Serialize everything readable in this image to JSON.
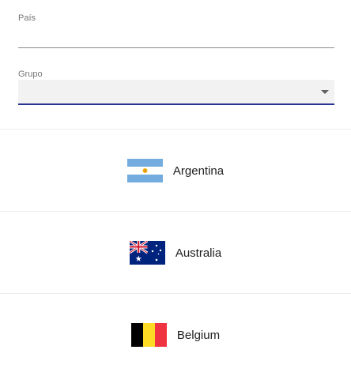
{
  "form": {
    "pais": {
      "label": "País",
      "value": ""
    },
    "grupo": {
      "label": "Grupo",
      "selected": "",
      "icon": "dropdown-arrow-icon"
    }
  },
  "countries": [
    {
      "name": "Argentina",
      "flag_icon": "argentina-flag-icon"
    },
    {
      "name": "Australia",
      "flag_icon": "australia-flag-icon"
    },
    {
      "name": "Belgium",
      "flag_icon": "belgium-flag-icon"
    }
  ],
  "colors": {
    "select_underline": "#283593",
    "select_background": "#f2f2f2",
    "divider": "#ececec"
  }
}
